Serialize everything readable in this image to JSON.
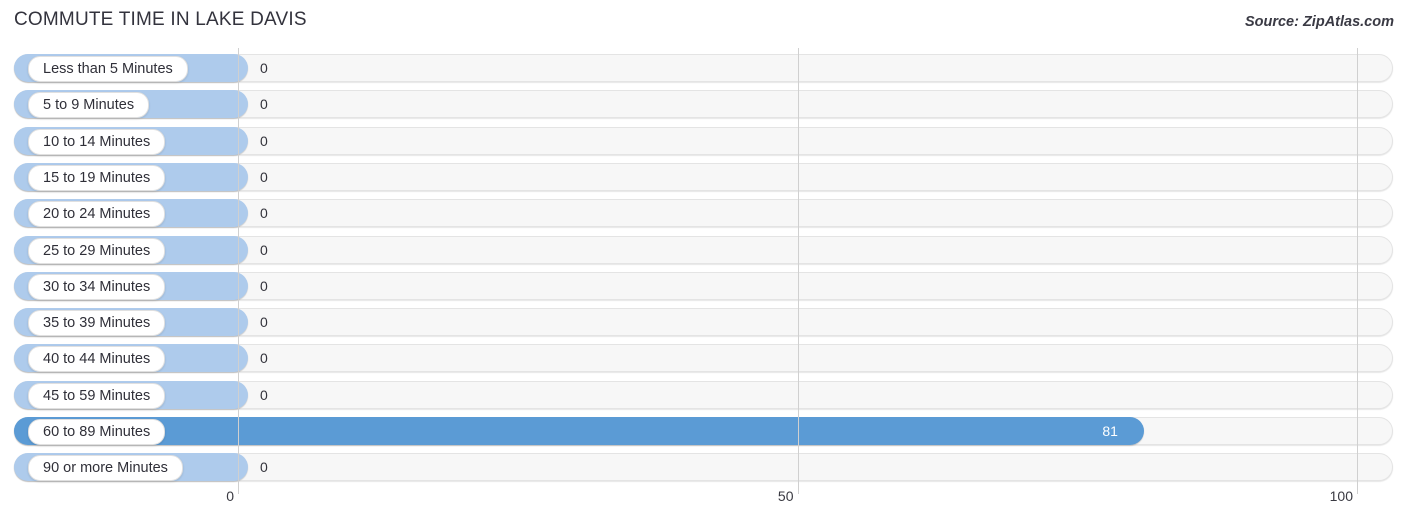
{
  "header": {
    "title": "COMMUTE TIME IN LAKE DAVIS",
    "source": "Source: ZipAtlas.com"
  },
  "colors": {
    "bar_zero": "#aecbec",
    "bar_highlight": "#5b9bd5",
    "track": "#f7f7f7",
    "gridline": "#d0d0d0",
    "title": "#33333d"
  },
  "axis": {
    "ticks": [
      {
        "label": "0",
        "value": 0
      },
      {
        "label": "50",
        "value": 50
      },
      {
        "label": "100",
        "value": 100
      }
    ],
    "min": 0,
    "max": 100
  },
  "chart_data": {
    "type": "bar",
    "orientation": "horizontal",
    "title": "COMMUTE TIME IN LAKE DAVIS",
    "subtitle": "Source: ZipAtlas.com",
    "xlabel": "",
    "ylabel": "",
    "xlim": [
      0,
      100
    ],
    "grid": true,
    "legend": false,
    "categories": [
      "Less than 5 Minutes",
      "5 to 9 Minutes",
      "10 to 14 Minutes",
      "15 to 19 Minutes",
      "20 to 24 Minutes",
      "25 to 29 Minutes",
      "30 to 34 Minutes",
      "35 to 39 Minutes",
      "40 to 44 Minutes",
      "45 to 59 Minutes",
      "60 to 89 Minutes",
      "90 or more Minutes"
    ],
    "values": [
      0,
      0,
      0,
      0,
      0,
      0,
      0,
      0,
      0,
      0,
      81,
      0
    ],
    "value_labels": [
      "0",
      "0",
      "0",
      "0",
      "0",
      "0",
      "0",
      "0",
      "0",
      "0",
      "81",
      "0"
    ]
  },
  "rows": [
    {
      "label": "Less than 5 Minutes",
      "value": 0,
      "value_label": "0"
    },
    {
      "label": "5 to 9 Minutes",
      "value": 0,
      "value_label": "0"
    },
    {
      "label": "10 to 14 Minutes",
      "value": 0,
      "value_label": "0"
    },
    {
      "label": "15 to 19 Minutes",
      "value": 0,
      "value_label": "0"
    },
    {
      "label": "20 to 24 Minutes",
      "value": 0,
      "value_label": "0"
    },
    {
      "label": "25 to 29 Minutes",
      "value": 0,
      "value_label": "0"
    },
    {
      "label": "30 to 34 Minutes",
      "value": 0,
      "value_label": "0"
    },
    {
      "label": "35 to 39 Minutes",
      "value": 0,
      "value_label": "0"
    },
    {
      "label": "40 to 44 Minutes",
      "value": 0,
      "value_label": "0"
    },
    {
      "label": "45 to 59 Minutes",
      "value": 0,
      "value_label": "0"
    },
    {
      "label": "60 to 89 Minutes",
      "value": 81,
      "value_label": "81"
    },
    {
      "label": "90 or more Minutes",
      "value": 0,
      "value_label": "0"
    }
  ]
}
